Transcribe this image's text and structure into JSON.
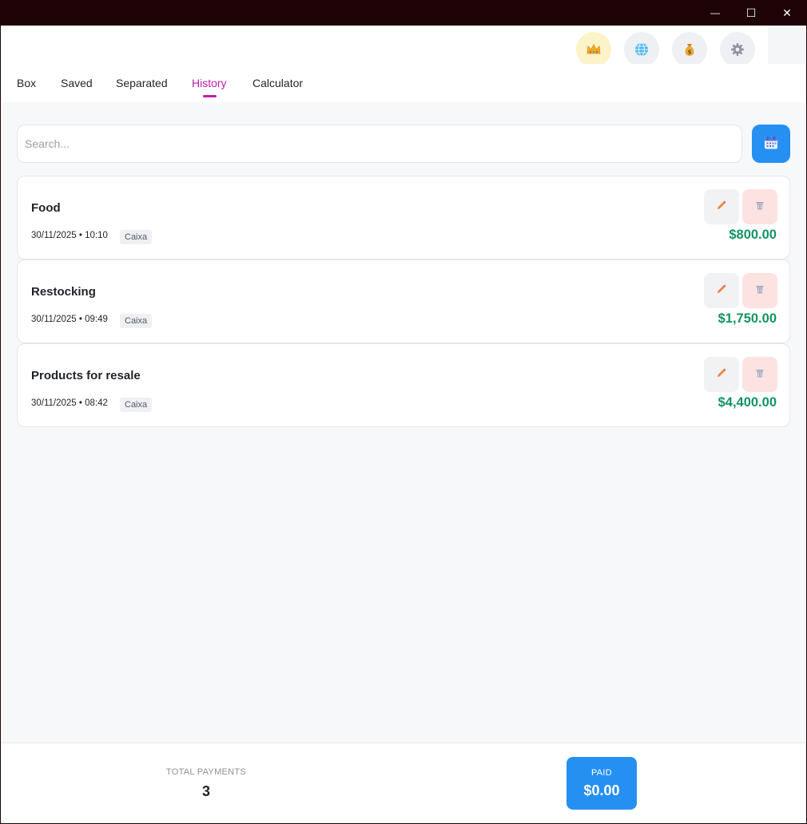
{
  "window": {
    "minimize_glyph": "—",
    "maximize_glyph": "☐",
    "close_glyph": "✕"
  },
  "header": {
    "icons": [
      "crown-icon",
      "globe-icon",
      "money-bag-icon",
      "gear-icon"
    ],
    "tabs": [
      {
        "label": "Box"
      },
      {
        "label": "Saved"
      },
      {
        "label": "Separated"
      },
      {
        "label": "History"
      },
      {
        "label": "Calculator"
      }
    ],
    "active_tab": "History",
    "accent_color": "#c21bb0"
  },
  "search": {
    "placeholder": "Search...",
    "value": ""
  },
  "entries": [
    {
      "title": "Food",
      "datetime": "30/11/2025 • 10:10",
      "tag": "Caixa",
      "amount": "$800.00"
    },
    {
      "title": "Restocking",
      "datetime": "30/11/2025 • 09:49",
      "tag": "Caixa",
      "amount": "$1,750.00"
    },
    {
      "title": "Products for resale",
      "datetime": "30/11/2025 • 08:42",
      "tag": "Caixa",
      "amount": "$4,400.00"
    }
  ],
  "footer": {
    "total_label": "TOTAL PAYMENTS",
    "total_value": "3",
    "paid_label": "PAID",
    "paid_value": "$0.00"
  },
  "colors": {
    "primary_button": "#2590f2",
    "amount_green": "#129462",
    "delete_bg": "#fde2e2"
  }
}
